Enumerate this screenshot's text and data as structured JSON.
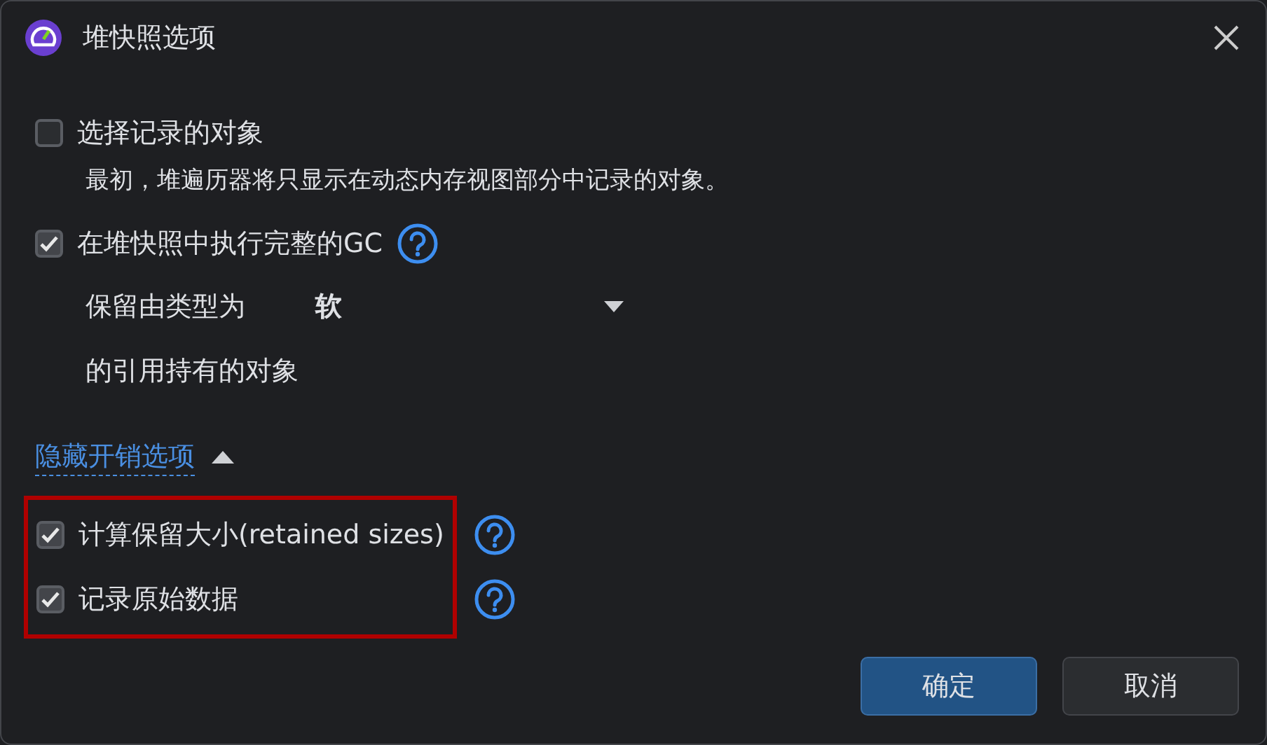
{
  "window": {
    "title": "堆快照选项"
  },
  "options": [
    {
      "label": "选择记录的对象",
      "checked": false,
      "help": false,
      "description": "最初，堆遍历器将只显示在动态内存视图部分中记录的对象。"
    },
    {
      "label": "在堆快照中执行完整的GC",
      "checked": true,
      "help": true
    }
  ],
  "retention": {
    "prefix": "保留由类型为",
    "value": "软",
    "suffix": "的引用持有的对象"
  },
  "overhead": {
    "link": "隐藏开销选项",
    "expanded": true,
    "highlighted": true,
    "options": [
      {
        "label": "计算保留大小(retained sizes)",
        "checked": true,
        "help": true
      },
      {
        "label": "记录原始数据",
        "checked": true,
        "help": true
      }
    ]
  },
  "buttons": [
    {
      "label": "确定",
      "kind": "primary"
    },
    {
      "label": "取消",
      "kind": "secondary"
    }
  ]
}
